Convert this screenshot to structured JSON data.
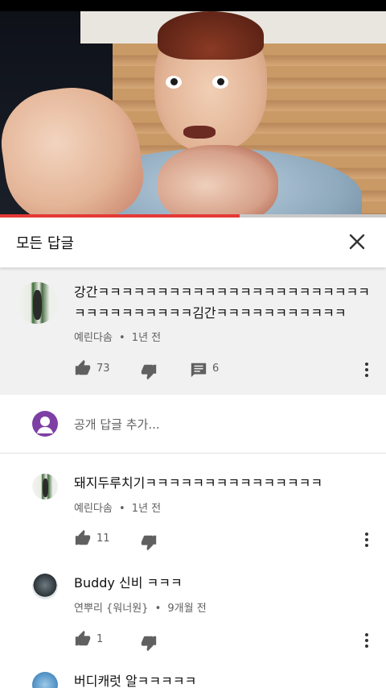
{
  "header": {
    "title": "모든 답글"
  },
  "video": {
    "progress_fraction": 0.62
  },
  "top_comment": {
    "text_line1": "강간ㅋㅋㅋㅋㅋㅋㅋㅋㅋㅋㅋㅋㅋㅋㅋㅋㅋㅋㅋㅋㅋㅋㅋ",
    "text_line2": "ㅋㅋㅋㅋㅋㅋㅋㅋㅋㅋ김간ㅋㅋㅋㅋㅋㅋㅋㅋㅋㅋㅋ",
    "author": "예린다솜",
    "time": "1년 전",
    "likes": "73",
    "replies": "6"
  },
  "reply_box": {
    "placeholder": "공개 답글 추가..."
  },
  "replies": [
    {
      "text": "돼지두루치기ㅋㅋㅋㅋㅋㅋㅋㅋㅋㅋㅋㅋㅋㅋㅋ",
      "author": "예린다솜",
      "time": "1년 전",
      "likes": "11"
    },
    {
      "text": "Buddy 신비 ㅋㅋㅋ",
      "author": "연뿌리 {워너원}",
      "time": "9개월 전",
      "likes": "1"
    },
    {
      "text": "버디캐럿 알ㅋㅋㅋㅋㅋ"
    }
  ],
  "separator": "•",
  "colors": {
    "progress": "#e53935",
    "highlight_bg": "#f1f1f1",
    "meta_text": "#606060"
  }
}
